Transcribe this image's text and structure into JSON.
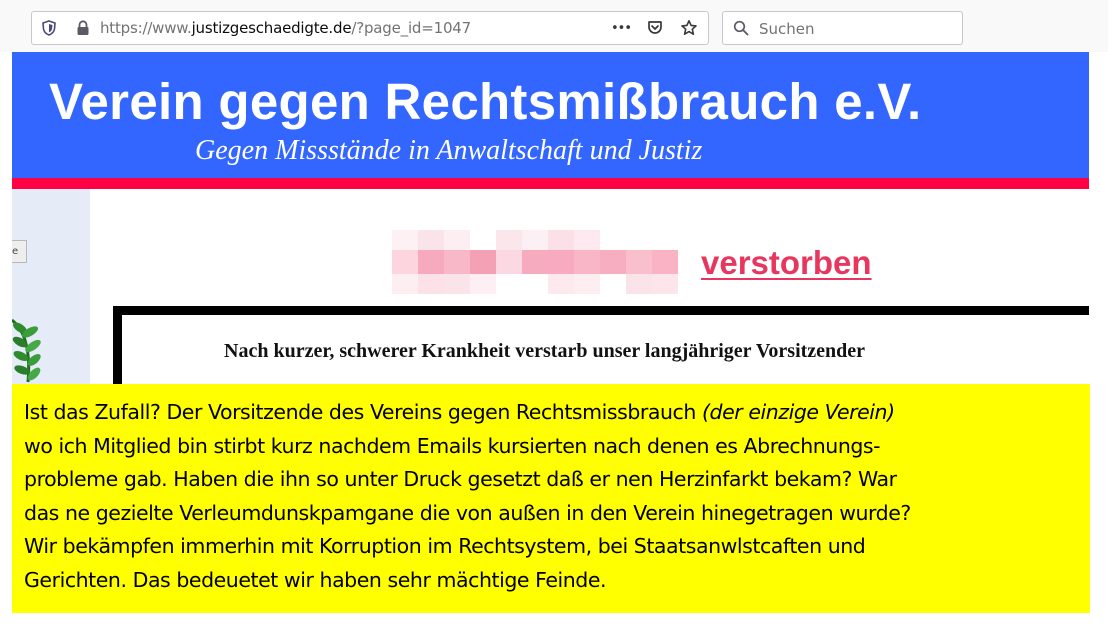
{
  "browser": {
    "url_prefix": "https://www.",
    "url_domain": "justizgeschaedigte.de",
    "url_suffix": "/?page_id=1047",
    "search_placeholder": "Suchen",
    "menu_glyph": "•••"
  },
  "site": {
    "title": "Verein gegen Rechtsmißbrauch e.V.",
    "subtitle": "Gegen Missstände in Anwaltschaft und Justiz",
    "header_color": "#3366ff",
    "accent_color": "#ff0044"
  },
  "article": {
    "headline": "verstorben",
    "notice": "Nach kurzer, schwerer Krankheit verstarb unser langjähriger Vorsitzender",
    "sidebar_button": "e"
  },
  "overlay": {
    "text_1": "Ist das Zufall? Der Vorsitzende des Vereins gegen Rechtsmissbrauch ",
    "text_italic": "(der einzige Verein)",
    "text_2": "\nwo ich Mitglied bin stirbt kurz nachdem Emails kursierten nach denen es Abrechnungs-\nprobleme gab. Haben die ihn so unter Druck gesetzt daß er nen Herzinfarkt bekam? War\ndas ne gezielte Verleumdunskpamgane die von außen in den Verein hinegetragen wurde?\nWir bekämpfen immerhin mit Korruption im Rechtsystem, bei Staatsanwlstcaften und\nGerichten. Das bedeuetet wir haben sehr mächtige Feinde.",
    "background": "#ffff00"
  }
}
